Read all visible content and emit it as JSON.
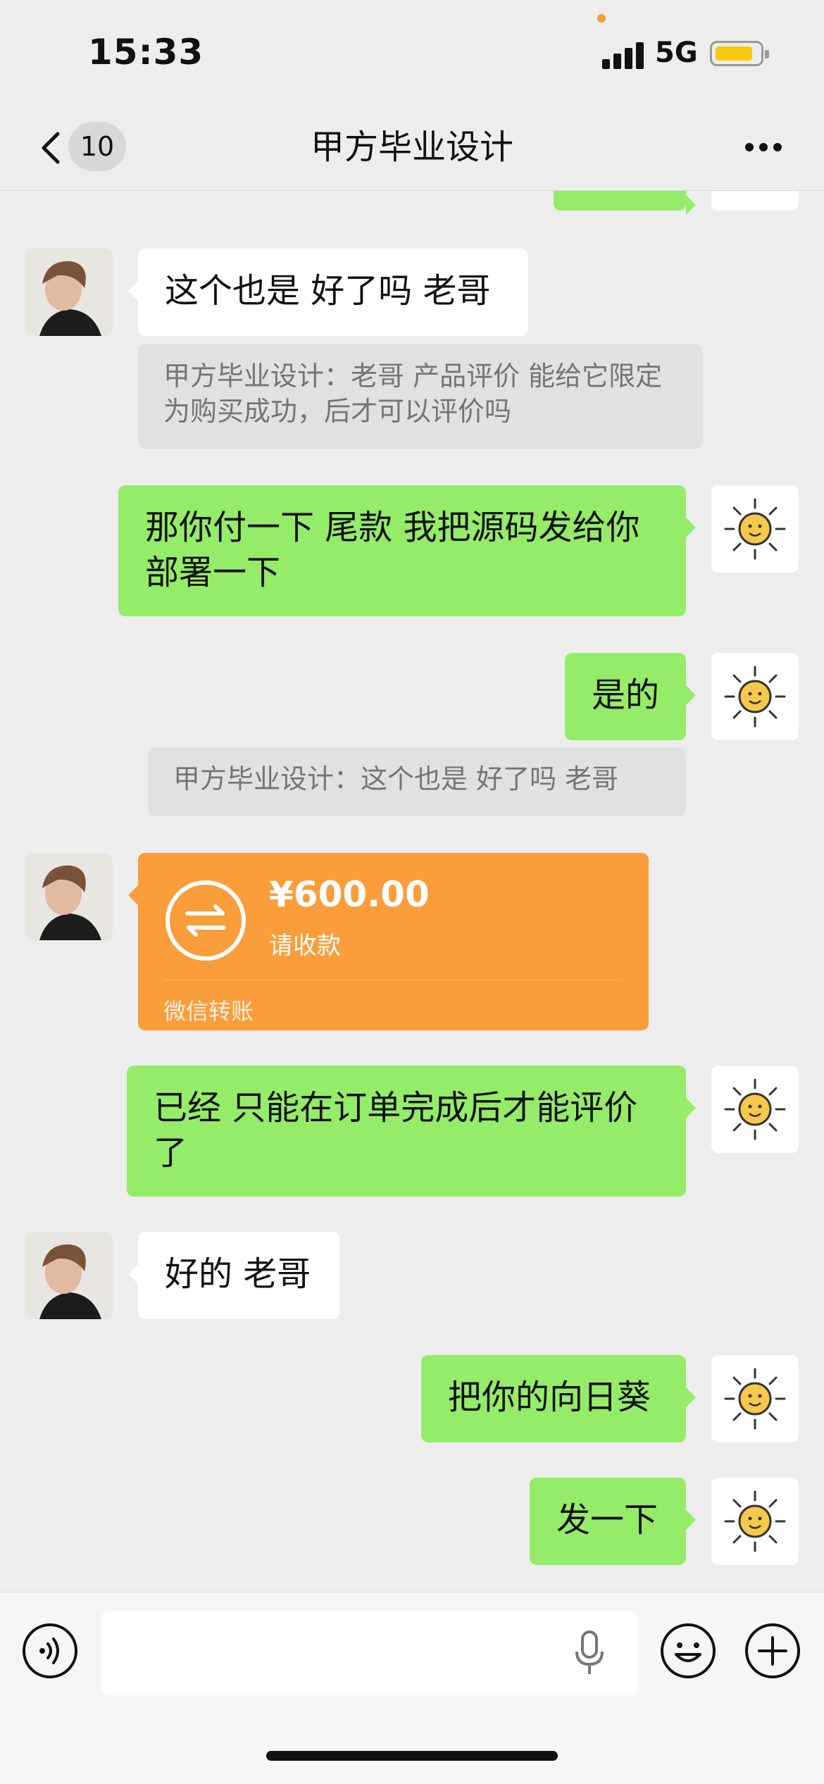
{
  "status_bar": {
    "time": "15:33",
    "network": "5G"
  },
  "nav": {
    "unread_count": "10",
    "title": "甲方毕业设计"
  },
  "messages": {
    "m1": "这个也是 好了吗 老哥",
    "q1": "甲方毕业设计：老哥 产品评价 能给它限定为购买成功，后才可以评价吗",
    "m2": "那你付一下 尾款 我把源码发给你部署一下",
    "m3": "是的",
    "q2": "甲方毕业设计：这个也是 好了吗 老哥",
    "m5": "已经 只能在订单完成后才能评价了",
    "m6": "好的 老哥",
    "m7": "把你的向日葵",
    "m8": "发一下"
  },
  "transfer": {
    "amount": "¥600.00",
    "status": "请收款",
    "label": "微信转账"
  },
  "colors": {
    "background": "#ededed",
    "outgoing_bubble": "#95ec69",
    "incoming_bubble": "#ffffff",
    "transfer_card": "#fa9d3b",
    "battery": "#f6c90e"
  },
  "icons": [
    "back-icon",
    "more-icon",
    "sun-avatar-icon",
    "transfer-arrows-icon",
    "voice-icon",
    "mic-icon",
    "emoji-icon",
    "plus-icon"
  ]
}
